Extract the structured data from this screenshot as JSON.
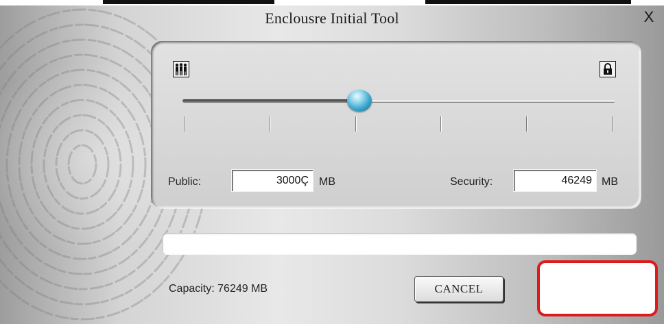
{
  "window": {
    "title": "Enclousre Initial Tool",
    "close_label": "X"
  },
  "slider": {
    "left_icon": "people-icon",
    "right_icon": "lock-icon",
    "level_fraction": 0.41,
    "tick_count": 6
  },
  "public": {
    "label": "Public:",
    "value": "3000Ç",
    "unit": "MB"
  },
  "security": {
    "label": "Security:",
    "value": "46249",
    "unit": "MB"
  },
  "progress": {
    "fraction": 0.0
  },
  "footer": {
    "capacity_text": "Capacity: 76249 MB",
    "cancel_label": "CANCEL",
    "ok_label": ""
  },
  "colors": {
    "accent": "#3aa5cc",
    "highlight": "#e01a1a"
  }
}
